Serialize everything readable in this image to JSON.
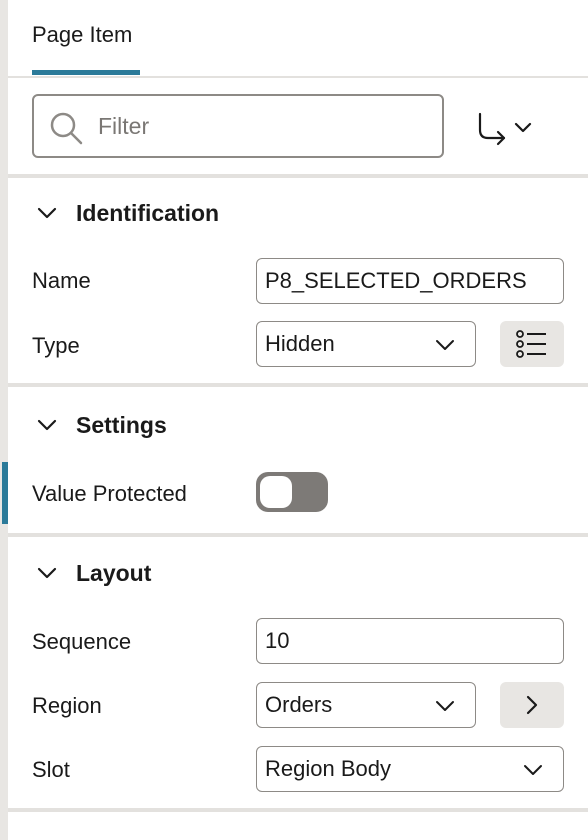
{
  "tab": {
    "label": "Page Item"
  },
  "filter": {
    "placeholder": "Filter"
  },
  "sections": {
    "identification": {
      "title": "Identification",
      "name_label": "Name",
      "name_value": "P8_SELECTED_ORDERS",
      "type_label": "Type",
      "type_value": "Hidden"
    },
    "settings": {
      "title": "Settings",
      "value_protected_label": "Value Protected",
      "value_protected_on": false
    },
    "layout": {
      "title": "Layout",
      "sequence_label": "Sequence",
      "sequence_value": "10",
      "region_label": "Region",
      "region_value": "Orders",
      "slot_label": "Slot",
      "slot_value": "Region Body"
    }
  },
  "colors": {
    "accent": "#2b7a99",
    "toggle_off": "#7d7a77",
    "border": "#8d8a86",
    "divider": "#e3e1de"
  },
  "icons": [
    "search-icon",
    "goto-arrow-icon",
    "chevron-down-icon",
    "list-icon",
    "chevron-right-icon"
  ]
}
